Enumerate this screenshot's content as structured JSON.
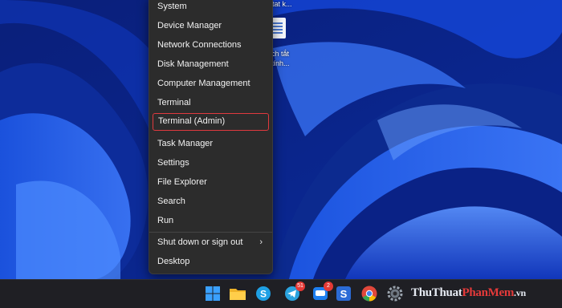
{
  "desktop": {
    "icon_label_line1": "rtat k...",
    "icon_label_line2": "ch tắt",
    "icon_label_line3": "tính..."
  },
  "menu": {
    "items": [
      {
        "label": "System"
      },
      {
        "label": "Device Manager"
      },
      {
        "label": "Network Connections"
      },
      {
        "label": "Disk Management"
      },
      {
        "label": "Computer Management"
      },
      {
        "label": "Terminal"
      },
      {
        "label": "Terminal (Admin)",
        "highlighted": true
      },
      {
        "label": "Task Manager"
      },
      {
        "label": "Settings"
      },
      {
        "label": "File Explorer"
      },
      {
        "label": "Search"
      },
      {
        "label": "Run"
      },
      {
        "label": "Shut down or sign out",
        "submenu": true
      },
      {
        "label": "Desktop"
      }
    ],
    "submenu_arrow": "›",
    "highlight_color": "#e0393e"
  },
  "taskbar": {
    "apps": [
      {
        "name": "start",
        "icon": "windows-start-icon"
      },
      {
        "name": "file-explorer",
        "icon": "folder-icon"
      },
      {
        "name": "skype",
        "icon": "skype-icon"
      },
      {
        "name": "telegram",
        "icon": "telegram-icon",
        "badge": "51"
      },
      {
        "name": "zalo",
        "icon": "zalo-icon",
        "badge": "2"
      },
      {
        "name": "snagit",
        "icon": "snagit-icon"
      },
      {
        "name": "chrome",
        "icon": "chrome-icon"
      },
      {
        "name": "settings",
        "icon": "gear-icon"
      }
    ]
  },
  "watermark": {
    "part1": "ThuThuat",
    "part2": "PhanMem",
    "part3": ".vn"
  },
  "colors": {
    "wallpaper": "#0b2fa6",
    "menu_bg": "#2c2c2c",
    "taskbar_bg": "#1f1f24",
    "accent": "#e0393e"
  }
}
